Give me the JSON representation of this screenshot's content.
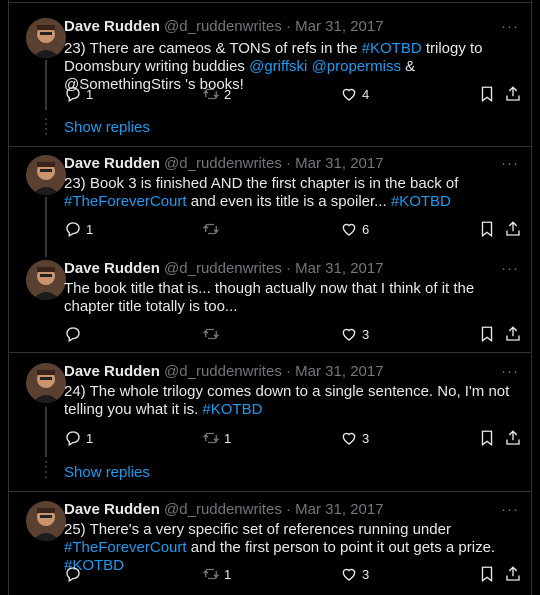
{
  "tweets": [
    {
      "name": "Dave Rudden",
      "handle": "@d_ruddenwrites",
      "dot": "·",
      "date": "Mar 31, 2017",
      "text_parts": [
        "23) There are cameos & TONS of refs in the ",
        "#KOTBD",
        " trilogy to Doomsbury writing buddies ",
        "@griffski",
        " ",
        "@propermiss",
        " & @SomethingStirs 's books!"
      ],
      "replies": "1",
      "retweets": "2",
      "likes": "4"
    },
    {
      "name": "Dave Rudden",
      "handle": "@d_ruddenwrites",
      "dot": "·",
      "date": "Mar 31, 2017",
      "text_parts": [
        "23) Book 3 is finished AND the first chapter is in the back of ",
        "#TheForeverCourt",
        " and even its title is a spoiler... ",
        "#KOTBD"
      ],
      "replies": "1",
      "retweets": "",
      "likes": "6"
    },
    {
      "name": "Dave Rudden",
      "handle": "@d_ruddenwrites",
      "dot": "·",
      "date": "Mar 31, 2017",
      "text_parts": [
        "The book title that is... though actually now that I think of it the chapter title totally is too..."
      ],
      "replies": "",
      "retweets": "",
      "likes": "3"
    },
    {
      "name": "Dave Rudden",
      "handle": "@d_ruddenwrites",
      "dot": "·",
      "date": "Mar 31, 2017",
      "text_parts": [
        "24) The whole trilogy comes down to a single sentence. No, I'm not telling you what it is. ",
        "#KOTBD"
      ],
      "replies": "1",
      "retweets": "1",
      "likes": "3"
    },
    {
      "name": "Dave Rudden",
      "handle": "@d_ruddenwrites",
      "dot": "·",
      "date": "Mar 31, 2017",
      "text_parts": [
        "25) There's a very specific set of references running under ",
        "#TheForeverCourt",
        " and the first person to point it out gets a prize. ",
        "#KOTBD"
      ],
      "replies": "",
      "retweets": "1",
      "likes": "3"
    }
  ],
  "show_replies_label": "Show replies",
  "more_label": "···",
  "colors": {
    "link": "#1d9bf0",
    "muted": "#71767b",
    "text": "#e7e9ea",
    "border": "#2f3336"
  }
}
